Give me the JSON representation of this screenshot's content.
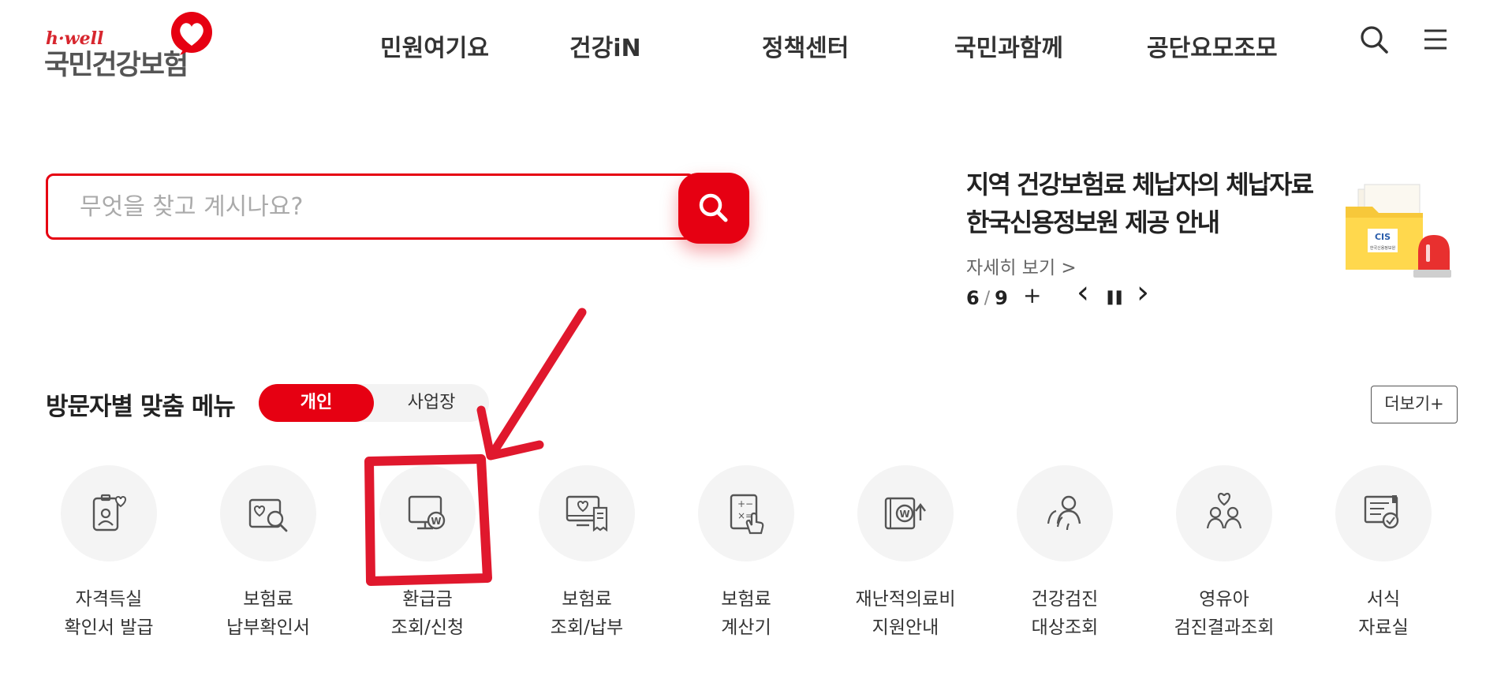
{
  "header": {
    "logo": {
      "small": "h·well",
      "big": "국민건강보험"
    },
    "nav": [
      {
        "label": "민원여기요"
      },
      {
        "label": "건강iN"
      },
      {
        "label": "정책센터"
      },
      {
        "label": "국민과함께"
      },
      {
        "label": "공단요모조모"
      }
    ],
    "icons": [
      "search-icon",
      "menu-icon"
    ]
  },
  "search": {
    "placeholder": "무엇을 찾고 계시나요?",
    "value": ""
  },
  "notice": {
    "title_line1": "지역 건강보험료 체납자의 체납자료",
    "title_line2": "한국신용정보원 제공 안내",
    "more": "자세히 보기 >",
    "page_current": "6",
    "page_sep": "/",
    "page_total": "9",
    "plus": "+",
    "prev": "‹",
    "pause": "❚❚",
    "next": "›",
    "illustration_label": "한국신용정보원"
  },
  "visitor_menu": {
    "title": "방문자별 맞춤 메뉴",
    "toggle": {
      "active": "개인",
      "inactive": "사업장"
    },
    "more_button": "더보기+",
    "items": [
      {
        "label": "자격득실\n확인서 발급",
        "icon": "id-card-heart-icon"
      },
      {
        "label": "보험료\n납부확인서",
        "icon": "certificate-search-icon"
      },
      {
        "label": "환급금\n조회/신청",
        "icon": "monitor-won-icon"
      },
      {
        "label": "보험료\n조회/납부",
        "icon": "monitor-receipt-icon"
      },
      {
        "label": "보험료\n계산기",
        "icon": "calculator-icon"
      },
      {
        "label": "재난적의료비\n지원안내",
        "icon": "wallet-won-up-icon"
      },
      {
        "label": "건강검진\n대상조회",
        "icon": "people-check-icon"
      },
      {
        "label": "영유아\n검진결과조회",
        "icon": "family-heart-icon"
      },
      {
        "label": "서식\n자료실",
        "icon": "form-check-icon"
      }
    ]
  },
  "colors": {
    "brand_red": "#e60012",
    "text": "#333333",
    "circle_bg": "#f4f4f4",
    "annotation": "#e0182d"
  }
}
